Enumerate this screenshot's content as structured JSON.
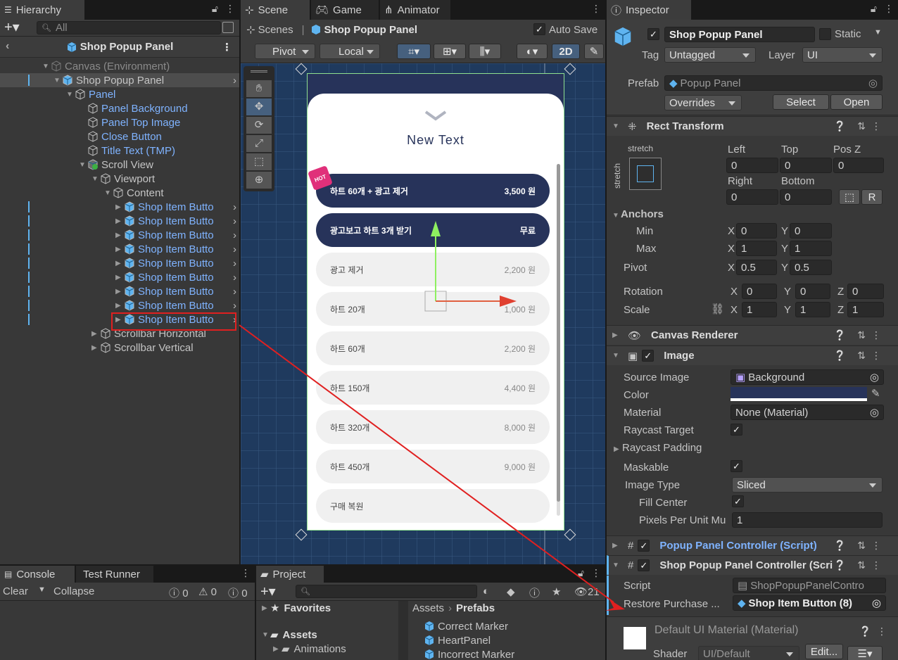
{
  "hierarchy": {
    "tab_label": "Hierarchy",
    "search_placeholder": "All",
    "breadcrumb_title": "Shop Popup Panel",
    "items": [
      {
        "label": "Canvas (Environment)"
      },
      {
        "label": "Shop Popup Panel"
      },
      {
        "label": "Panel"
      },
      {
        "label": "Panel Background"
      },
      {
        "label": "Panel Top Image"
      },
      {
        "label": "Close Button"
      },
      {
        "label": "Title Text (TMP)"
      },
      {
        "label": "Scroll View"
      },
      {
        "label": "Viewport"
      },
      {
        "label": "Content"
      },
      {
        "label": "Shop Item Butto"
      },
      {
        "label": "Shop Item Butto"
      },
      {
        "label": "Shop Item Butto"
      },
      {
        "label": "Shop Item Butto"
      },
      {
        "label": "Shop Item Butto"
      },
      {
        "label": "Shop Item Butto"
      },
      {
        "label": "Shop Item Butto"
      },
      {
        "label": "Shop Item Butto"
      },
      {
        "label": "Shop Item Butto"
      },
      {
        "label": "Scrollbar Horizontal"
      },
      {
        "label": "Scrollbar Vertical"
      }
    ]
  },
  "scene": {
    "tabs": [
      "Scene",
      "Game",
      "Animator"
    ],
    "scenes_label": "Scenes",
    "prefab_title": "Shop Popup Panel",
    "auto_save_label": "Auto Save",
    "pivot_label": "Pivot",
    "local_label": "Local",
    "mode_2d": "2D",
    "popup_title": "New Text",
    "hot_badge": "HOT",
    "items": [
      {
        "name": "하트 60개 + 광고 제거",
        "price": "3,500 원"
      },
      {
        "name": "광고보고 하트 3개 받기",
        "price": "무료"
      },
      {
        "name": "광고 제거",
        "price": "2,200 원"
      },
      {
        "name": "하트 20개",
        "price": "1,000 원"
      },
      {
        "name": "하트 60개",
        "price": "2,200 원"
      },
      {
        "name": "하트 150개",
        "price": "4,400 원"
      },
      {
        "name": "하트 320개",
        "price": "8,000 원"
      },
      {
        "name": "하트 450개",
        "price": "9,000 원"
      },
      {
        "name": "구매 복원",
        "price": ""
      }
    ]
  },
  "console": {
    "tabs": [
      "Console",
      "Test Runner"
    ],
    "clear": "Clear",
    "collapse": "Collapse",
    "counts": [
      "0",
      "0",
      "0"
    ]
  },
  "project": {
    "tab_label": "Project",
    "favorites": "Favorites",
    "assets": "Assets",
    "animations": "Animations",
    "breadcrumb": [
      "Assets",
      "Prefabs"
    ],
    "hidden_count": "21",
    "files": [
      "Correct Marker",
      "HeartPanel",
      "Incorrect Marker"
    ]
  },
  "inspector": {
    "tab_label": "Inspector",
    "object_name": "Shop Popup Panel",
    "static_label": "Static",
    "tag_label": "Tag",
    "tag_value": "Untagged",
    "layer_label": "Layer",
    "layer_value": "UI",
    "prefab_label": "Prefab",
    "prefab_value": "Popup Panel",
    "overrides": "Overrides",
    "select": "Select",
    "open": "Open",
    "rect_transform": {
      "title": "Rect Transform",
      "stretch_h": "stretch",
      "stretch_v": "stretch",
      "left_label": "Left",
      "left": "0",
      "top_label": "Top",
      "top": "0",
      "posz_label": "Pos Z",
      "posz": "0",
      "right_label": "Right",
      "right": "0",
      "bottom_label": "Bottom",
      "bottom": "0",
      "anchors": "Anchors",
      "min": "Min",
      "min_x": "0",
      "min_y": "0",
      "max": "Max",
      "max_x": "1",
      "max_y": "1",
      "pivot": "Pivot",
      "pivot_x": "0.5",
      "pivot_y": "0.5",
      "rotation": "Rotation",
      "rot_x": "0",
      "rot_y": "0",
      "rot_z": "0",
      "scale": "Scale",
      "scale_x": "1",
      "scale_y": "1",
      "scale_z": "1",
      "x": "X",
      "y": "Y",
      "z": "Z",
      "r": "R"
    },
    "canvas_renderer": "Canvas Renderer",
    "image": {
      "title": "Image",
      "source_image_label": "Source Image",
      "source_image": "Background",
      "color_label": "Color",
      "color_value": "#27335a",
      "material_label": "Material",
      "material": "None (Material)",
      "raycast_target": "Raycast Target",
      "raycast_padding": "Raycast Padding",
      "maskable": "Maskable",
      "image_type_label": "Image Type",
      "image_type": "Sliced",
      "fill_center": "Fill Center",
      "ppu_label": "Pixels Per Unit Mu",
      "ppu": "1"
    },
    "popup_controller": "Popup Panel Controller (Script)",
    "shop_controller": {
      "title": "Shop Popup Panel Controller (Scri",
      "script_label": "Script",
      "script": "ShopPopupPanelContro",
      "restore_label": "Restore Purchase ...",
      "restore_value": "Shop Item Button (8)"
    },
    "material_footer": {
      "name": "Default UI Material (Material)",
      "shader_label": "Shader",
      "shader": "UI/Default",
      "edit": "Edit..."
    }
  },
  "colors": {
    "accent_blue": "#7fb3ff",
    "annotation_red": "#e02020",
    "scene_bg": "#1f3a5e",
    "popup_dark": "#27335a"
  }
}
